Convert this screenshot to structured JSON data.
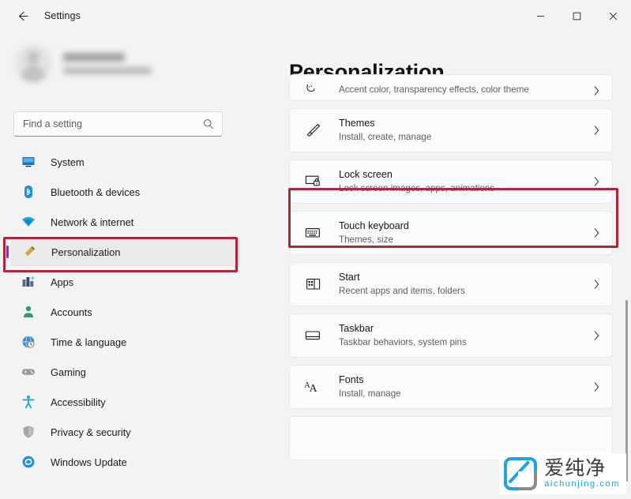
{
  "window": {
    "title": "Settings",
    "back_icon": "arrow-left-icon",
    "controls": [
      {
        "name": "minimize",
        "icon": "minimize-icon"
      },
      {
        "name": "maximize",
        "icon": "maximize-icon"
      },
      {
        "name": "close",
        "icon": "close-icon"
      }
    ]
  },
  "profile": {
    "redacted": true,
    "avatar_icon": "user-avatar-icon"
  },
  "search": {
    "placeholder": "Find a setting",
    "value": "",
    "icon": "search-icon"
  },
  "sidebar": {
    "selected": "Personalization",
    "items": [
      {
        "label": "System",
        "icon": "monitor-icon",
        "color": "#1e72b8"
      },
      {
        "label": "Bluetooth & devices",
        "icon": "bluetooth-icon",
        "color": "#1e90d8"
      },
      {
        "label": "Network & internet",
        "icon": "wifi-icon",
        "color": "#22a8e0"
      },
      {
        "label": "Personalization",
        "icon": "paintbrush-icon",
        "color": "#c9972e"
      },
      {
        "label": "Apps",
        "icon": "apps-icon",
        "color": "#4a5a7a"
      },
      {
        "label": "Accounts",
        "icon": "person-icon",
        "color": "#2e9e6e"
      },
      {
        "label": "Time & language",
        "icon": "clock-globe-icon",
        "color": "#3d8fd0"
      },
      {
        "label": "Gaming",
        "icon": "gamepad-icon",
        "color": "#8a8a8a"
      },
      {
        "label": "Accessibility",
        "icon": "accessibility-icon",
        "color": "#29a8d8"
      },
      {
        "label": "Privacy & security",
        "icon": "shield-icon",
        "color": "#9a9a9a"
      },
      {
        "label": "Windows Update",
        "icon": "update-icon",
        "color": "#1e90d8"
      }
    ]
  },
  "main": {
    "title": "Personalization",
    "items": [
      {
        "title": "",
        "subtitle": "Accent color, transparency effects, color theme",
        "icon": "color-palette-icon",
        "clipped": true
      },
      {
        "title": "Themes",
        "subtitle": "Install, create, manage",
        "icon": "paintbrush-icon",
        "clipped": false
      },
      {
        "title": "Lock screen",
        "subtitle": "Lock screen images, apps, animations",
        "icon": "lock-screen-icon",
        "clipped": false
      },
      {
        "title": "Touch keyboard",
        "subtitle": "Themes, size",
        "icon": "keyboard-icon",
        "clipped": false
      },
      {
        "title": "Start",
        "subtitle": "Recent apps and items, folders",
        "icon": "start-layout-icon",
        "clipped": false
      },
      {
        "title": "Taskbar",
        "subtitle": "Taskbar behaviors, system pins",
        "icon": "taskbar-icon",
        "clipped": false
      },
      {
        "title": "Fonts",
        "subtitle": "Install, manage",
        "icon": "fonts-icon",
        "clipped": false
      }
    ]
  },
  "annotations": {
    "color": "#a8293c",
    "targets": [
      "Personalization",
      "Lock screen"
    ]
  },
  "watermark": {
    "cn": "爱纯净",
    "en": "aichunjing.com",
    "brand_color": "#22a0e8"
  }
}
